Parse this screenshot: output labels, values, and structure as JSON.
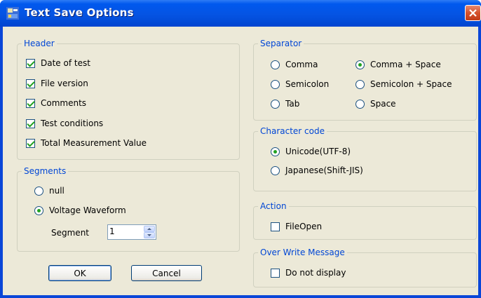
{
  "window": {
    "title": "Text Save Options",
    "icon": "app-icon",
    "close_icon": "close-icon"
  },
  "header_group": {
    "legend": "Header",
    "items": [
      {
        "label": "Date of test",
        "checked": true
      },
      {
        "label": "File version",
        "checked": true
      },
      {
        "label": "Comments",
        "checked": true
      },
      {
        "label": "Test conditions",
        "checked": true
      },
      {
        "label": "Total Measurement Value",
        "checked": true
      }
    ]
  },
  "segments_group": {
    "legend": "Segments",
    "options": [
      {
        "label": "null",
        "selected": false
      },
      {
        "label": "Voltage Waveform",
        "selected": true
      }
    ],
    "segment_label": "Segment",
    "segment_value": "1"
  },
  "separator_group": {
    "legend": "Separator",
    "options": [
      {
        "label": "Comma",
        "selected": false
      },
      {
        "label": "Comma + Space",
        "selected": true
      },
      {
        "label": "Semicolon",
        "selected": false
      },
      {
        "label": "Semicolon + Space",
        "selected": false
      },
      {
        "label": "Tab",
        "selected": false
      },
      {
        "label": "Space",
        "selected": false
      }
    ]
  },
  "charcode_group": {
    "legend": "Character code",
    "options": [
      {
        "label": "Unicode(UTF-8)",
        "selected": true
      },
      {
        "label": "Japanese(Shift-JIS)",
        "selected": false
      }
    ]
  },
  "action_group": {
    "legend": "Action",
    "checkbox": {
      "label": "FileOpen",
      "checked": false
    }
  },
  "overwrite_group": {
    "legend": "Over Write Message",
    "checkbox": {
      "label": "Do not display",
      "checked": false
    }
  },
  "buttons": {
    "ok": "OK",
    "cancel": "Cancel"
  },
  "colors": {
    "title_bar": "#0054e3",
    "dialog_bg": "#ece9d8",
    "legend_text": "#0046d5",
    "check_mark": "#21a121"
  }
}
